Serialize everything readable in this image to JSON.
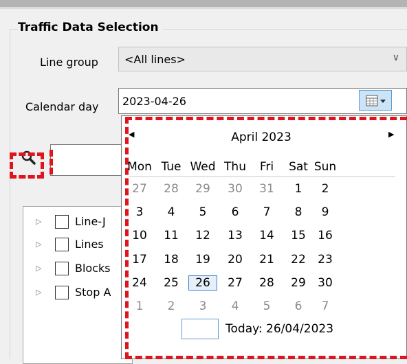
{
  "group": {
    "title": "Traffic Data Selection"
  },
  "line_group": {
    "label": "Line group",
    "value": "<All lines>"
  },
  "calendar_day": {
    "label": "Calendar day",
    "value": "2023-04-26"
  },
  "tree": {
    "items": [
      {
        "label": "Line-J"
      },
      {
        "label": "Lines"
      },
      {
        "label": "Blocks"
      },
      {
        "label": "Stop A"
      }
    ]
  },
  "calendar": {
    "month_label": "April 2023",
    "weekdays": [
      "Mon",
      "Tue",
      "Wed",
      "Thu",
      "Fri",
      "Sat",
      "Sun"
    ],
    "weeks": [
      [
        "27",
        "28",
        "29",
        "30",
        "31",
        "1",
        "2"
      ],
      [
        "3",
        "4",
        "5",
        "6",
        "7",
        "8",
        "9"
      ],
      [
        "10",
        "11",
        "12",
        "13",
        "14",
        "15",
        "16"
      ],
      [
        "17",
        "18",
        "19",
        "20",
        "21",
        "22",
        "23"
      ],
      [
        "24",
        "25",
        "26",
        "27",
        "28",
        "29",
        "30"
      ],
      [
        "1",
        "2",
        "3",
        "4",
        "5",
        "6",
        "7"
      ]
    ],
    "selected_day": "26",
    "today_label": "Today: 26/04/2023"
  },
  "colors": {
    "highlight": "#e0141e",
    "selected_border": "#3c78c8",
    "button_fill": "#cce4f7"
  }
}
